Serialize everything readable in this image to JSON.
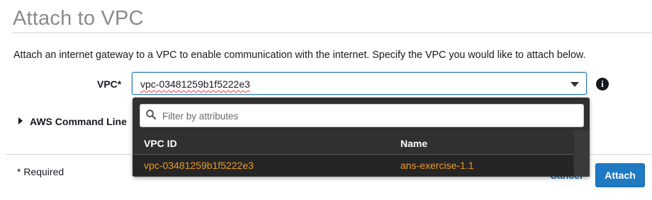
{
  "page": {
    "title": "Attach to VPC",
    "description": "Attach an internet gateway to a VPC to enable communication with the internet. Specify the VPC you would like to attach below."
  },
  "form": {
    "vpc_label": "VPC*",
    "vpc_value": "vpc-03481259b1f5222e3",
    "info_glyph": "i",
    "cli_section_label": "AWS Command Line"
  },
  "dropdown": {
    "filter_placeholder": "Filter by attributes",
    "columns": [
      "VPC ID",
      "Name"
    ],
    "rows": [
      {
        "vpc_id": "vpc-03481259b1f5222e3",
        "name": "ans-exercise-1.1"
      }
    ]
  },
  "footer": {
    "required_note": "* Required",
    "cancel_label": "Cancel",
    "attach_label": "Attach"
  },
  "colors": {
    "accent": "#1f7ac3",
    "row_text": "#ec9a2a",
    "dropdown_bg": "#303030"
  },
  "icons": [
    "search-icon",
    "info-icon",
    "caret-down-icon",
    "expand-triangle-icon"
  ]
}
